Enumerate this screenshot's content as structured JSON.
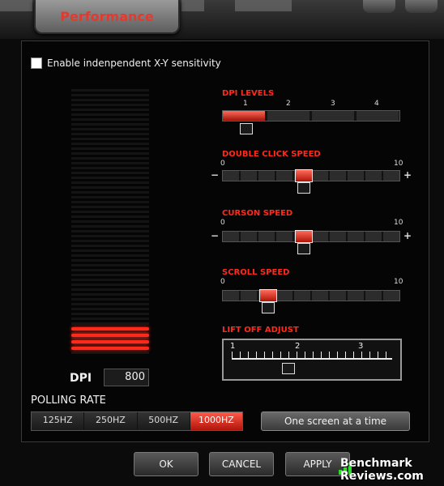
{
  "window": {
    "tab_title": "Performance"
  },
  "options": {
    "independent_xy_label": "Enable indenpendent X-Y sensitivity",
    "independent_xy_checked": false
  },
  "dpi": {
    "label": "DPI",
    "value": "800",
    "meter_level_bars": 4
  },
  "dpi_levels": {
    "title": "DPI LEVELS",
    "levels": [
      "1",
      "2",
      "3",
      "4"
    ],
    "selected_level": 1
  },
  "double_click_speed": {
    "title": "DOUBLE CLICK SPEED",
    "min": "0",
    "max": "10",
    "minus": "−",
    "plus": "+",
    "value": 5
  },
  "cursor_speed": {
    "title": "CURSON SPEED",
    "min": "0",
    "max": "10",
    "minus": "−",
    "plus": "+",
    "value": 5
  },
  "scroll_speed": {
    "title": "SCROLL SPEED",
    "min": "0",
    "max": "10",
    "value": 3
  },
  "lift_off_adjust": {
    "title": "LIFT OFF ADJUST",
    "scale_labels": [
      "1",
      "2",
      "3"
    ],
    "value": 1.8
  },
  "polling_rate": {
    "title": "POLLING RATE",
    "options": [
      "125HZ",
      "250HZ",
      "500HZ",
      "1000HZ"
    ],
    "selected": "1000HZ"
  },
  "screen_button": {
    "label": "One screen at a time"
  },
  "buttons": {
    "ok": "OK",
    "cancel": "CANCEL",
    "apply": "APPLY"
  },
  "watermark": {
    "line1": "Benchmark",
    "line2": "Reviews.com"
  },
  "colors": {
    "accent": "#ff2a1c",
    "background": "#050505"
  }
}
